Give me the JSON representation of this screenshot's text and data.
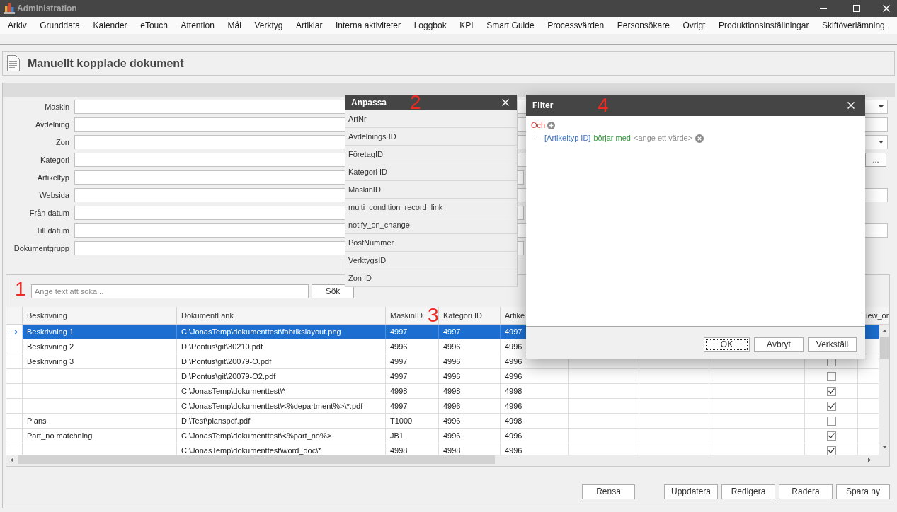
{
  "window": {
    "title": "Administration"
  },
  "menu": [
    "Arkiv",
    "Grunddata",
    "Kalender",
    "eTouch",
    "Attention",
    "Mål",
    "Verktyg",
    "Artiklar",
    "Interna aktiviteter",
    "Loggbok",
    "KPI",
    "Smart Guide",
    "Processvärden",
    "Personsökare",
    "Övrigt",
    "Produktionsinställningar",
    "Skiftöverlämning"
  ],
  "page": {
    "title": "Manuellt kopplade dokument"
  },
  "form": {
    "fields": [
      {
        "label": "Maskin",
        "kind": "combo"
      },
      {
        "label": "Avdelning",
        "kind": "text"
      },
      {
        "label": "Zon",
        "kind": "combo"
      },
      {
        "label": "Kategori",
        "kind": "browse",
        "button": "..."
      },
      {
        "label": "Artikeltyp",
        "kind": "short"
      },
      {
        "label": "Websida",
        "kind": "text"
      },
      {
        "label": "Från datum",
        "kind": "short"
      },
      {
        "label": "Till datum",
        "kind": "text"
      },
      {
        "label": "Dokumentgrupp",
        "kind": "short"
      }
    ]
  },
  "search": {
    "marker": "1",
    "placeholder": "Ange text att söka...",
    "button": "Sök"
  },
  "table": {
    "marker": "3",
    "columns": [
      {
        "kind": "text",
        "label": "Beskrivning"
      },
      {
        "kind": "text",
        "label": "DokumentLänk"
      },
      {
        "kind": "text",
        "label": "MaskinID"
      },
      {
        "kind": "text",
        "label": "Kategori ID"
      },
      {
        "kind": "text",
        "label": "Artike"
      },
      {
        "kind": "text"
      },
      {
        "kind": "text"
      },
      {
        "kind": "text"
      },
      {
        "kind": "check"
      },
      {
        "kind": "text",
        "label": "iew_or"
      }
    ],
    "rows": [
      {
        "selected": true,
        "description": "Beskrivning 1",
        "link": "C:\\JonasTemp\\dokumenttest\\fabrikslayout.png",
        "maskin_id": "4997",
        "kategori_id": "4997",
        "column_5": "4997"
      },
      {
        "selected": false,
        "description": "Beskrivning 2",
        "link": "D:\\Pontus\\git\\30210.pdf",
        "maskin_id": "4996",
        "kategori_id": "4996",
        "column_5": "4996"
      },
      {
        "selected": false,
        "description": "Beskrivning 3",
        "link": "D:\\Pontus\\git\\20079-O.pdf",
        "maskin_id": "4997",
        "kategori_id": "4996",
        "column_5": "4996",
        "checked": false
      },
      {
        "selected": false,
        "link": "D:\\Pontus\\git\\20079-O2.pdf",
        "maskin_id": "4997",
        "kategori_id": "4996",
        "column_5": "4996",
        "checked": false
      },
      {
        "selected": false,
        "link": "C:\\JonasTemp\\dokumenttest\\*",
        "maskin_id": "4998",
        "kategori_id": "4998",
        "column_5": "4998",
        "checked": true
      },
      {
        "selected": false,
        "link": "C:\\JonasTemp\\dokumenttest\\<%department%>\\*.pdf",
        "maskin_id": "4997",
        "kategori_id": "4996",
        "column_5": "4996",
        "checked": true
      },
      {
        "selected": false,
        "description": "Plans",
        "link": "D:\\Test\\planspdf.pdf",
        "maskin_id": "T1000",
        "kategori_id": "4996",
        "column_5": "4998",
        "checked": false
      },
      {
        "selected": false,
        "description": "Part_no matchning",
        "link": "C:\\JonasTemp\\dokumenttest\\<%part_no%>",
        "maskin_id": "JB1",
        "kategori_id": "4996",
        "column_5": "4996",
        "checked": true
      },
      {
        "selected": false,
        "link": "C:\\JonasTemp\\dokumenttest\\word_doc\\*",
        "maskin_id": "4998",
        "kategori_id": "4998",
        "column_5": "4996",
        "checked": true
      }
    ]
  },
  "actions": {
    "left": [
      "Rensa"
    ],
    "right": [
      "Uppdatera",
      "Redigera",
      "Radera",
      "Spara ny"
    ]
  },
  "customize_dialog": {
    "title": "Anpassa",
    "marker": "2",
    "items": [
      "ArtNr",
      "Avdelnings ID",
      "FöretagID",
      "Kategori ID",
      "MaskinID",
      "multi_condition_record_link",
      "notify_on_change",
      "PostNummer",
      "VerktygsID",
      "Zon ID"
    ]
  },
  "filter_dialog": {
    "title": "Filter",
    "marker": "4",
    "operator": "Och",
    "conditions": [
      {
        "field": "[Artikeltyp ID]",
        "operation": "börjar med",
        "value": "<ange ett värde>"
      }
    ],
    "buttons": [
      {
        "label": "OK",
        "focused": true
      },
      {
        "label": "Avbryt",
        "focused": false
      },
      {
        "label": "Verkställ",
        "focused": false
      }
    ]
  }
}
